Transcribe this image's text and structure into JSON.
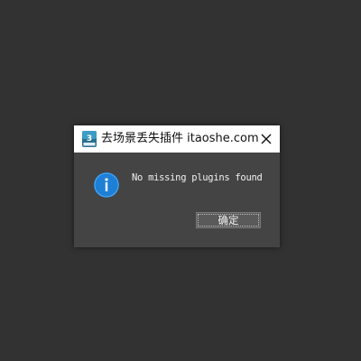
{
  "dialog": {
    "title": "去场景丢失插件 itaoshe.com",
    "app_icon": "3dsmax-icon",
    "close_icon": "close-icon",
    "message_icon": "info-icon",
    "message": "No missing plugins found",
    "ok_label": "确定"
  },
  "colors": {
    "background": "#323232",
    "dialog_body": "#444444",
    "titlebar": "#ffffff",
    "info_blue": "#1e7fd6",
    "button": "#5a5a5a"
  }
}
